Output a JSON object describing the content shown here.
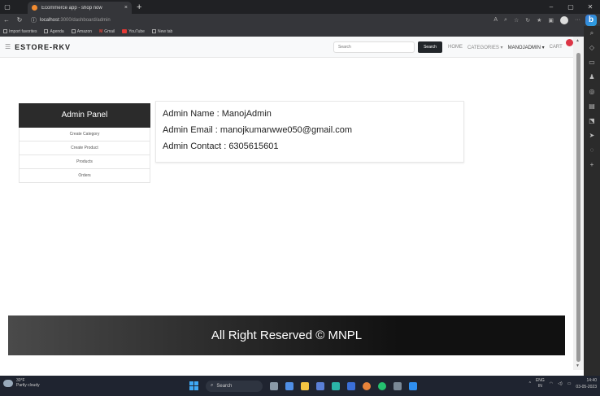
{
  "browser": {
    "tab_title": "Ecommerce app - shop now",
    "tab_close": "×",
    "new_tab": "+",
    "url_host": "localhost",
    "url_path": ":3000/dashboard/admin",
    "favorites": [
      "Import favorites",
      "Agenda",
      "Amazon",
      "Gmail",
      "YouTube",
      "New tab"
    ]
  },
  "navbar": {
    "brand": "ESTORE-RKV",
    "search_placeholder": "Search",
    "search_button": "Search",
    "home": "HOME",
    "categories": "CATEGORIES ▾",
    "user": "MANOJADMIN ▾",
    "cart": "CART"
  },
  "admin_panel": {
    "title": "Admin Panel",
    "items": [
      "Create Category",
      "Create Product",
      "Products",
      "Orders"
    ]
  },
  "admin_info": {
    "name": "Admin Name : ManojAdmin",
    "email": "Admin Email : manojkumarwwe050@gmail.com",
    "contact": "Admin Contact : 6305615601"
  },
  "footer": {
    "text": "All Right Reserved © MNPL"
  },
  "taskbar": {
    "temp": "30°F",
    "weather": "Partly cloudy",
    "search": "Search",
    "lang": "ENG",
    "region": "IN",
    "time": "14:40",
    "date": "03-05-2023"
  }
}
